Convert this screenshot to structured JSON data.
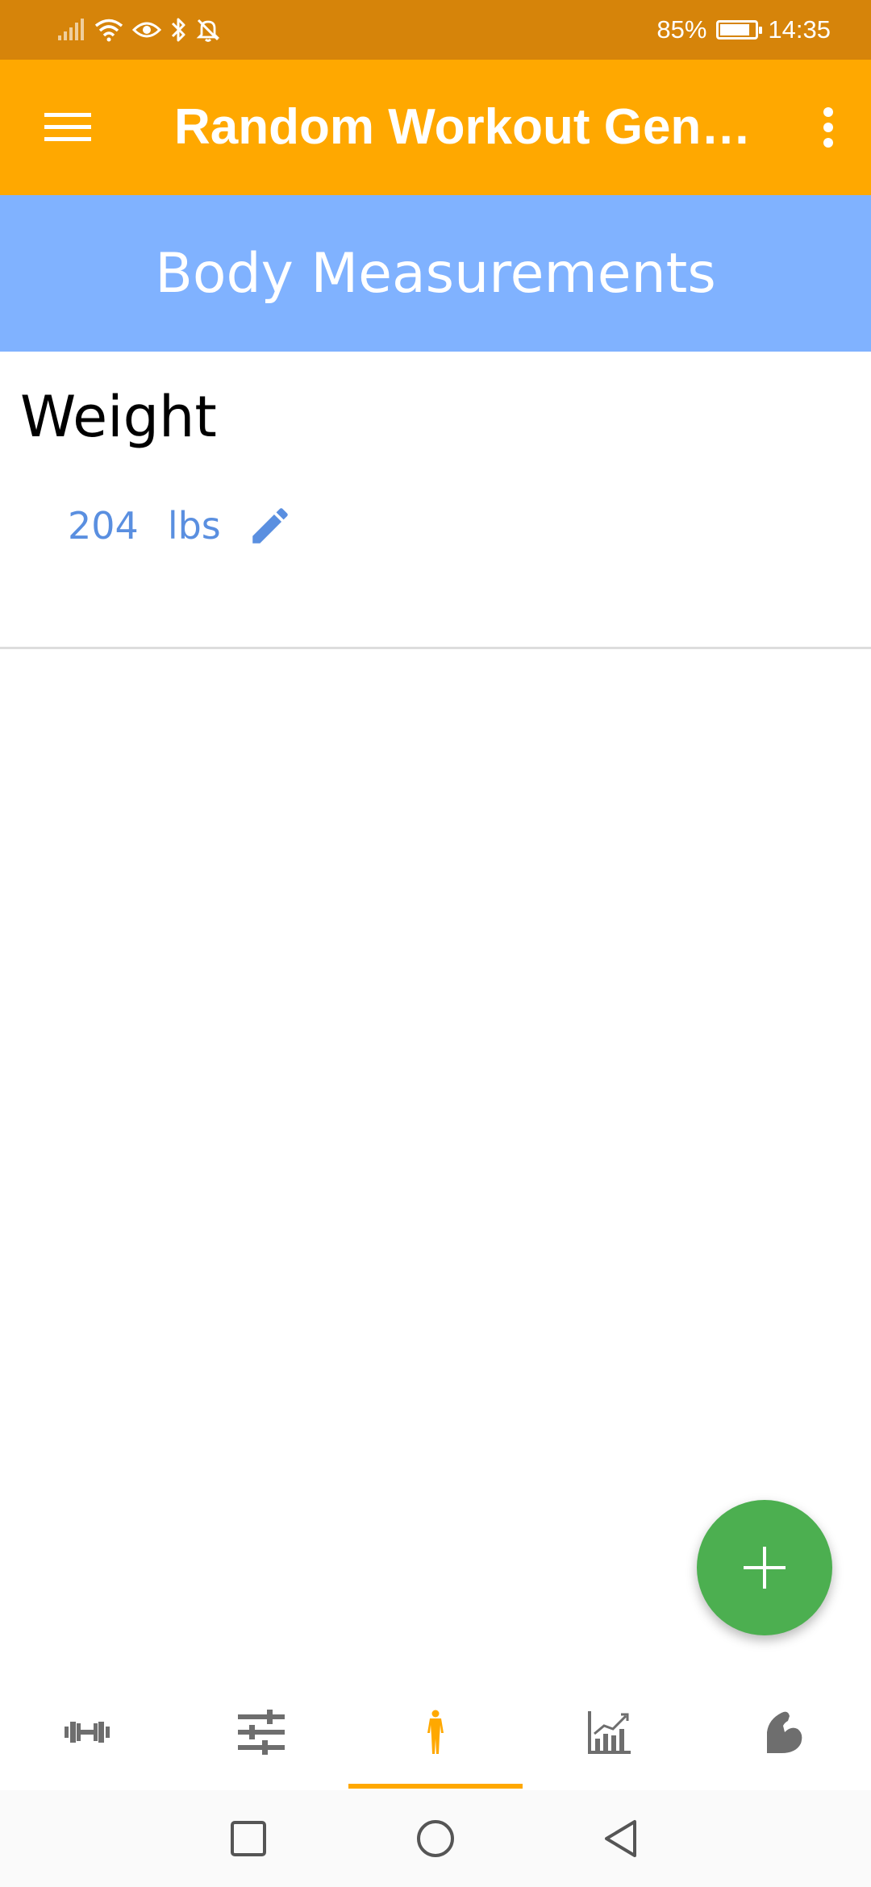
{
  "status_bar": {
    "battery_percent": "85%",
    "battery_level": 0.85,
    "time": "14:35",
    "icons": [
      "signal-icon",
      "wifi-icon",
      "eye-icon",
      "bluetooth-icon",
      "notifications-off-icon",
      "battery-icon"
    ]
  },
  "app_bar": {
    "title": "Random Workout Gen…",
    "menu_icon": "hamburger-menu-icon",
    "overflow_icon": "more-vert-icon"
  },
  "section": {
    "title": "Body Measurements"
  },
  "measurement": {
    "label": "Weight",
    "value": "204",
    "unit": "lbs",
    "edit_icon": "pencil-icon"
  },
  "fab": {
    "icon": "plus-icon",
    "color": "#4caf50"
  },
  "bottom_nav": {
    "items": [
      {
        "icon": "dumbbell-icon",
        "active": false
      },
      {
        "icon": "sliders-icon",
        "active": false
      },
      {
        "icon": "human-figure-icon",
        "active": true
      },
      {
        "icon": "chart-icon",
        "active": false
      },
      {
        "icon": "flexed-arm-icon",
        "active": false
      }
    ],
    "active_color": "#ffa800",
    "inactive_color": "#6e6e6e"
  },
  "system_nav": {
    "icons": [
      "recent-apps-icon",
      "home-icon",
      "back-icon"
    ]
  },
  "colors": {
    "status_bar": "#d6840a",
    "app_bar": "#ffa800",
    "section_header": "#80b2ff",
    "accent_blue": "#5a8fe0"
  }
}
